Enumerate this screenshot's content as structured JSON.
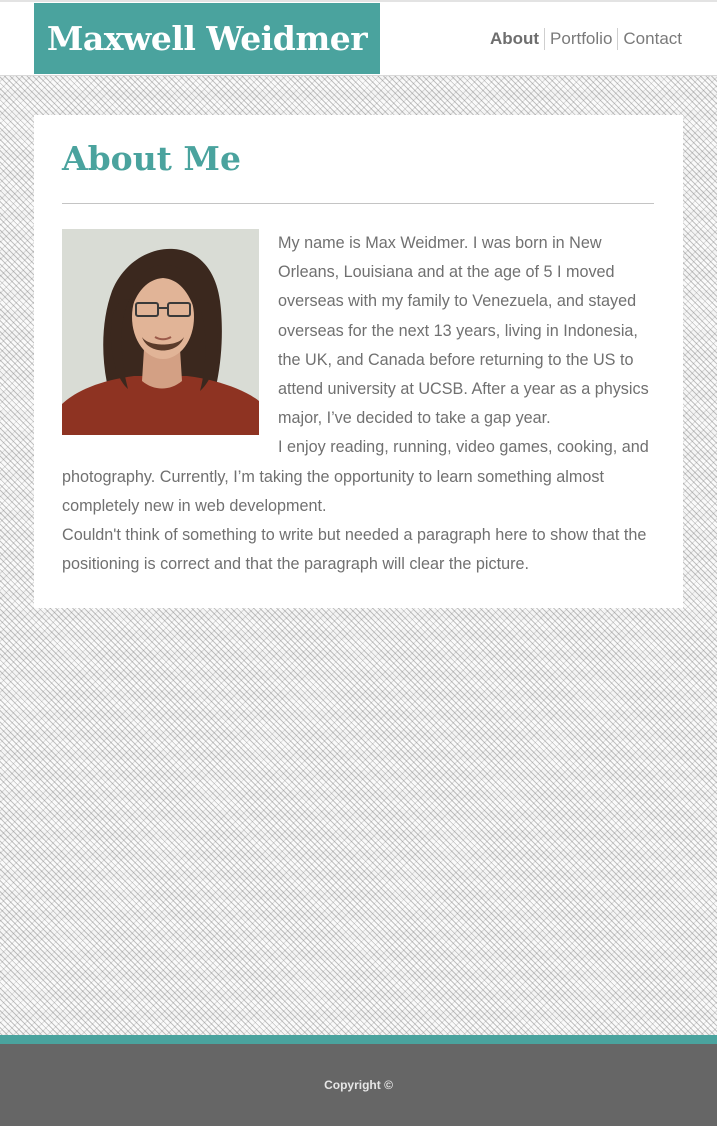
{
  "header": {
    "site_title": "Maxwell Weidmer",
    "nav": [
      {
        "label": "About"
      },
      {
        "label": "Portfolio"
      },
      {
        "label": "Contact"
      }
    ]
  },
  "main": {
    "title": "About Me",
    "paragraphs": [
      "My name is Max Weidmer. I was born in New Orleans, Louisiana and at the age of 5 I moved overseas with my family to Venezuela, and stayed overseas for the next 13 years, living in Indonesia, the UK, and Canada before returning to the US to attend university at UCSB. After a year as a physics major, I’ve decided to take a gap year.",
      "I enjoy reading, running, video games, cooking, and photography. Currently, I’m taking the opportunity to learn something almost completely new in web development.",
      "Couldn't think of something to write but needed a paragraph here to show that the positioning is correct and that the paragraph will clear the picture."
    ]
  },
  "footer": {
    "copyright": "Copyright ©"
  },
  "colors": {
    "accent": "#4aa39e",
    "footer_bg": "#666666",
    "text": "#707070"
  }
}
